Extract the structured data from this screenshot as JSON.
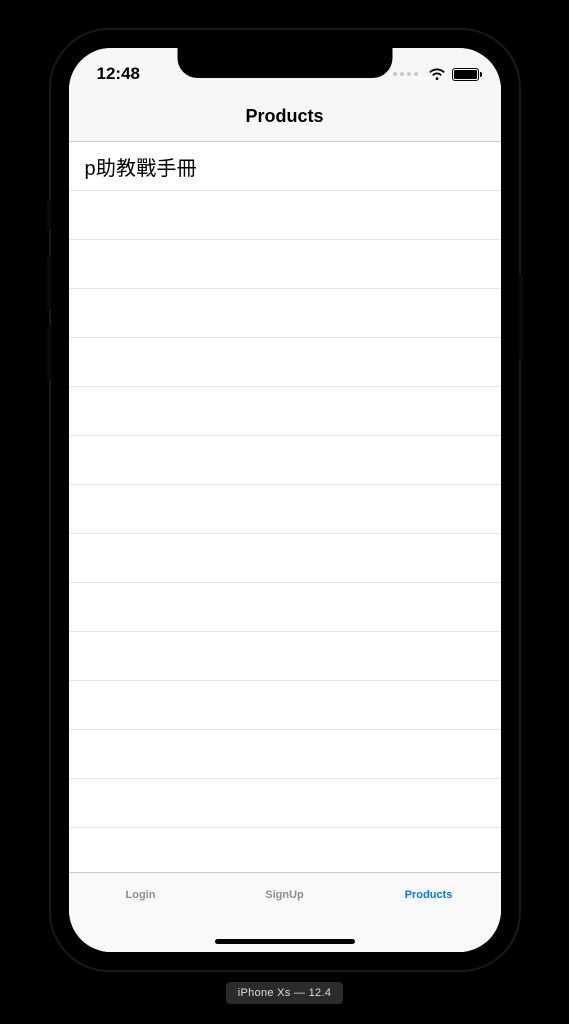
{
  "status": {
    "time": "12:48"
  },
  "nav": {
    "title": "Products"
  },
  "rows": [
    "p助教戰手冊",
    "",
    "",
    "",
    "",
    "",
    "",
    "",
    "",
    "",
    "",
    "",
    "",
    ""
  ],
  "tabs": {
    "login": "Login",
    "signup": "SignUp",
    "products": "Products"
  },
  "device": {
    "label": "iPhone Xs — 12.4"
  }
}
